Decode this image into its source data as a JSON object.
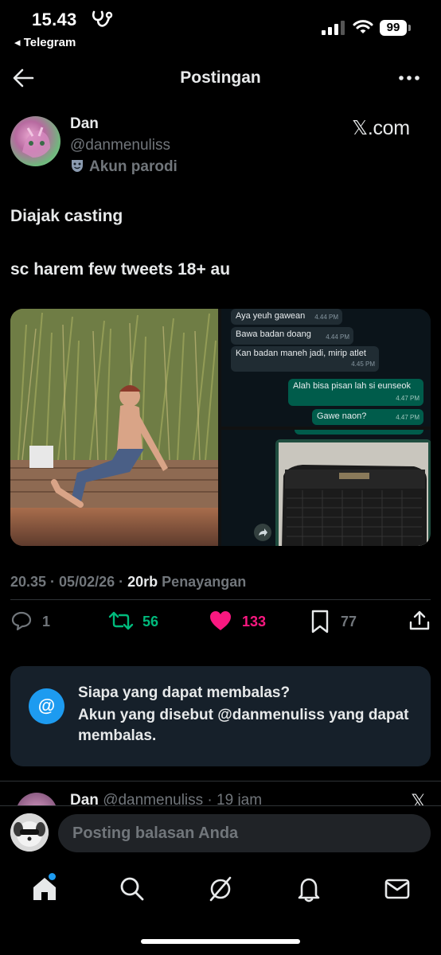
{
  "status_bar": {
    "time": "15.43",
    "back_app": "◂ Telegram",
    "battery": "99"
  },
  "header": {
    "title": "Postingan"
  },
  "post": {
    "author_name": "Dan",
    "author_handle": "@danmenuliss",
    "parody_label": "Akun parodi",
    "source": "𝕏.com",
    "text_line1": "Diajak casting",
    "text_line2": "sc harem few tweets 18+ au",
    "chat_messages": [
      {
        "text": "Aya yeuh gawean",
        "time": "4.44 PM",
        "side": "in"
      },
      {
        "text": "Bawa badan doang",
        "time": "4.44 PM",
        "side": "in"
      },
      {
        "text": "Kan badan maneh jadi, mirip atlet",
        "time": "4.45 PM",
        "side": "in"
      },
      {
        "text": "Alah bisa pisan lah si eunseok",
        "time": "4.47 PM",
        "side": "out"
      },
      {
        "text": "Gawe naon?",
        "time": "4.47 PM",
        "side": "out"
      }
    ],
    "meta": {
      "time": "20.35",
      "date": "05/02/26",
      "views_count": "20rb",
      "views_label": "Penayangan"
    },
    "actions": {
      "replies": "1",
      "reposts": "56",
      "likes": "133",
      "bookmarks": "77"
    },
    "colors": {
      "repost": "#00ba7c",
      "like": "#f91880",
      "accent": "#1d9bf0"
    }
  },
  "reply_restriction": {
    "title": "Siapa yang dapat membalas?",
    "description": "Akun yang disebut @danmenuliss yang dapat membalas."
  },
  "next_tweet": {
    "name": "Dan",
    "meta": "@danmenuliss · 19 jam"
  },
  "compose": {
    "placeholder": "Posting balasan Anda"
  }
}
